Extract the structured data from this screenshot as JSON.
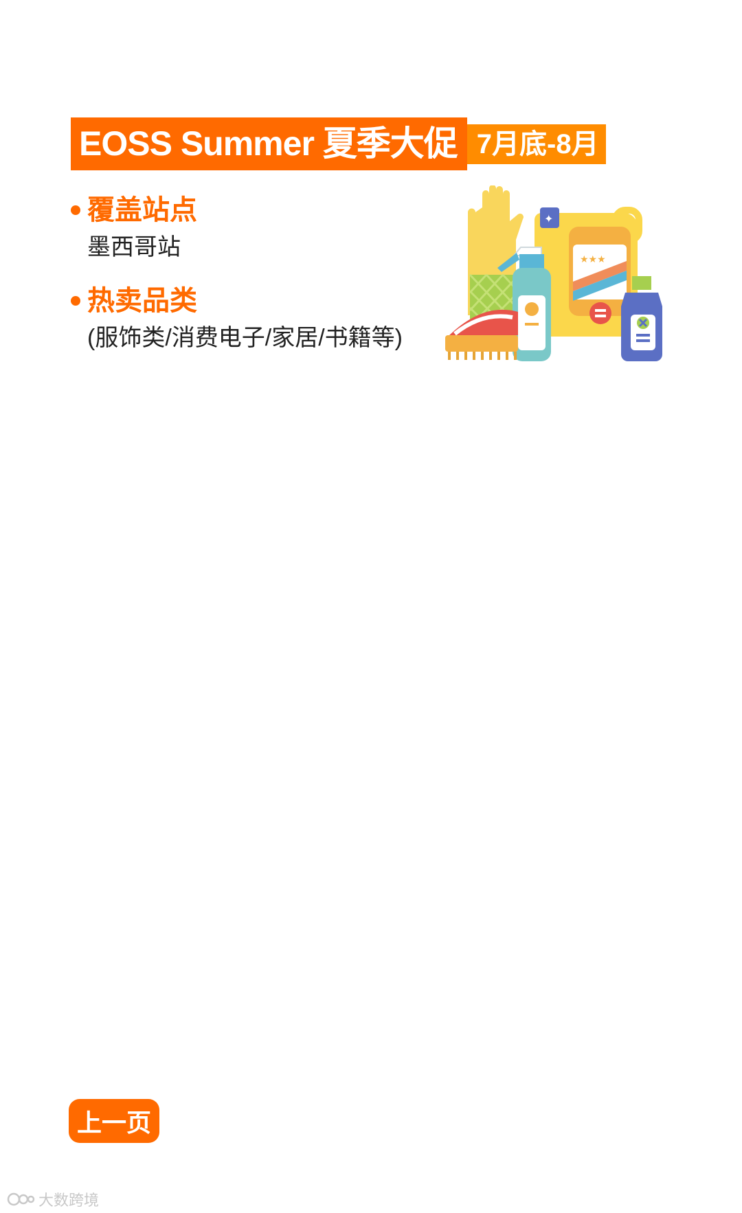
{
  "header": {
    "title": "EOSS Summer 夏季大促",
    "date_range": "7月底-8月"
  },
  "sections": [
    {
      "title": "覆盖站点",
      "body": "墨西哥站"
    },
    {
      "title": "热卖品类",
      "body": "(服饰类/消费电子/家居/书籍等)"
    }
  ],
  "nav": {
    "prev_label": "上一页"
  },
  "watermark": {
    "text": "大数跨境"
  },
  "colors": {
    "accent": "#ff6a00",
    "accent_light": "#ff8c00"
  }
}
